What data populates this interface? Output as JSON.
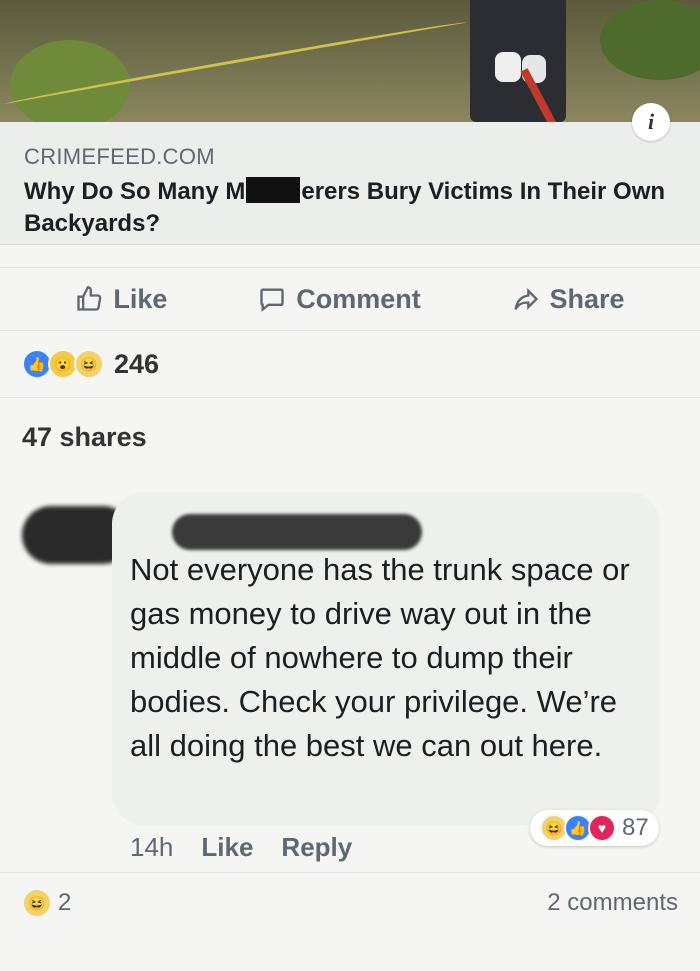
{
  "post": {
    "source": "CRIMEFEED.COM",
    "headline_part1": "Why Do So Many M",
    "headline_part2": "erers Bury Victims In Their Own Backyards?",
    "info_icon": "i"
  },
  "actions": {
    "like": "Like",
    "comment": "Comment",
    "share": "Share"
  },
  "reactions": {
    "count": "246",
    "icons": [
      "like-icon",
      "wow-icon",
      "haha-icon"
    ]
  },
  "shares": "47 shares",
  "comment": {
    "text": "Not everyone has the trunk space or gas money to drive way out in the middle of nowhere to dump their bodies. Check your privilege. We’re all doing the best we can out here.",
    "time": "14h",
    "like_label": "Like",
    "reply_label": "Reply",
    "reaction_count": "87"
  },
  "footer": {
    "reaction_count": "2",
    "comments": "2 comments"
  },
  "colors": {
    "accent_blue": "#3b82f6",
    "love_red": "#e0245e",
    "text_gray": "#606770"
  }
}
